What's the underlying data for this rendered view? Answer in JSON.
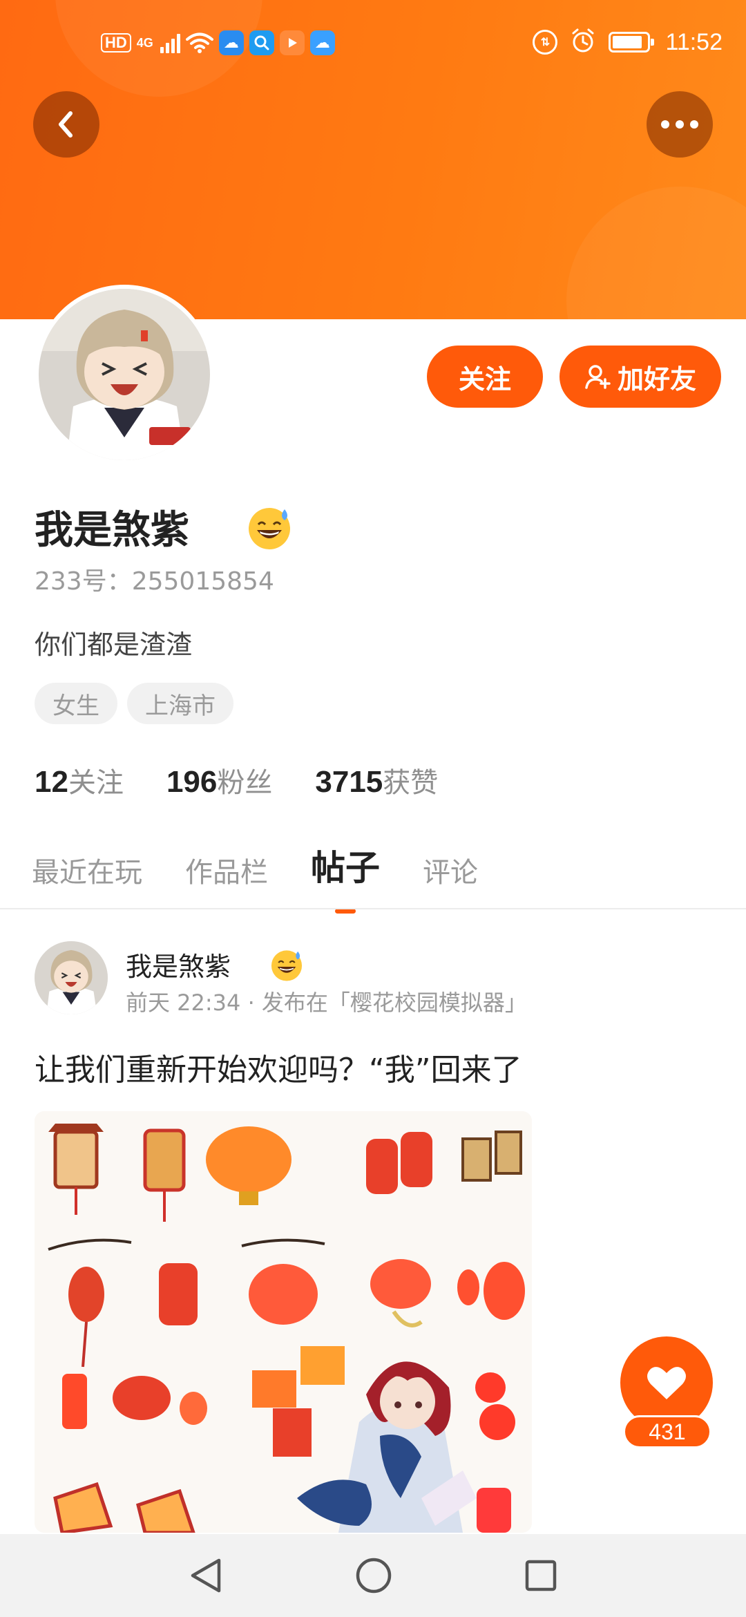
{
  "status_bar": {
    "hd": "HD",
    "network": "4G",
    "time": "11:52",
    "battery_level": 0.8,
    "left_icons": [
      "wifi-icon",
      "weather-app-icon",
      "search-app-icon",
      "video-app-icon",
      "cloud-app-icon"
    ],
    "right_icons": [
      "data-saver-icon",
      "alarm-icon",
      "battery-icon"
    ]
  },
  "header": {
    "back_icon": "chevron-left-icon",
    "more_icon": "more-dots-icon",
    "banner_color": "#ff7412"
  },
  "actions": {
    "follow_label": "关注",
    "add_friend_label": "加好友",
    "accent": "#ff5a0a"
  },
  "profile": {
    "name": "我是煞紫",
    "name_emoji": "sweat-smile-emoji",
    "uid_label": "233号：",
    "uid": "255015854",
    "bio": "你们都是渣渣",
    "tags": [
      "女生",
      "上海市"
    ]
  },
  "stats": [
    {
      "num": "12",
      "label": "关注"
    },
    {
      "num": "196",
      "label": "粉丝"
    },
    {
      "num": "3715",
      "label": "获赞"
    }
  ],
  "tabs": [
    {
      "label": "最近在玩",
      "active": false
    },
    {
      "label": "作品栏",
      "active": false
    },
    {
      "label": "帖子",
      "active": true
    },
    {
      "label": "评论",
      "active": false
    }
  ],
  "post": {
    "author": "我是煞紫",
    "meta": "前天 22:34 · 发布在「樱花校园模拟器」",
    "title": "让我们重新开始欢迎吗？“我”回来了",
    "image": "lanterns-anime-girl-image"
  },
  "like": {
    "count": "431",
    "icon": "heart-icon"
  },
  "system_nav": [
    "back-triangle-icon",
    "home-circle-icon",
    "recents-square-icon"
  ]
}
